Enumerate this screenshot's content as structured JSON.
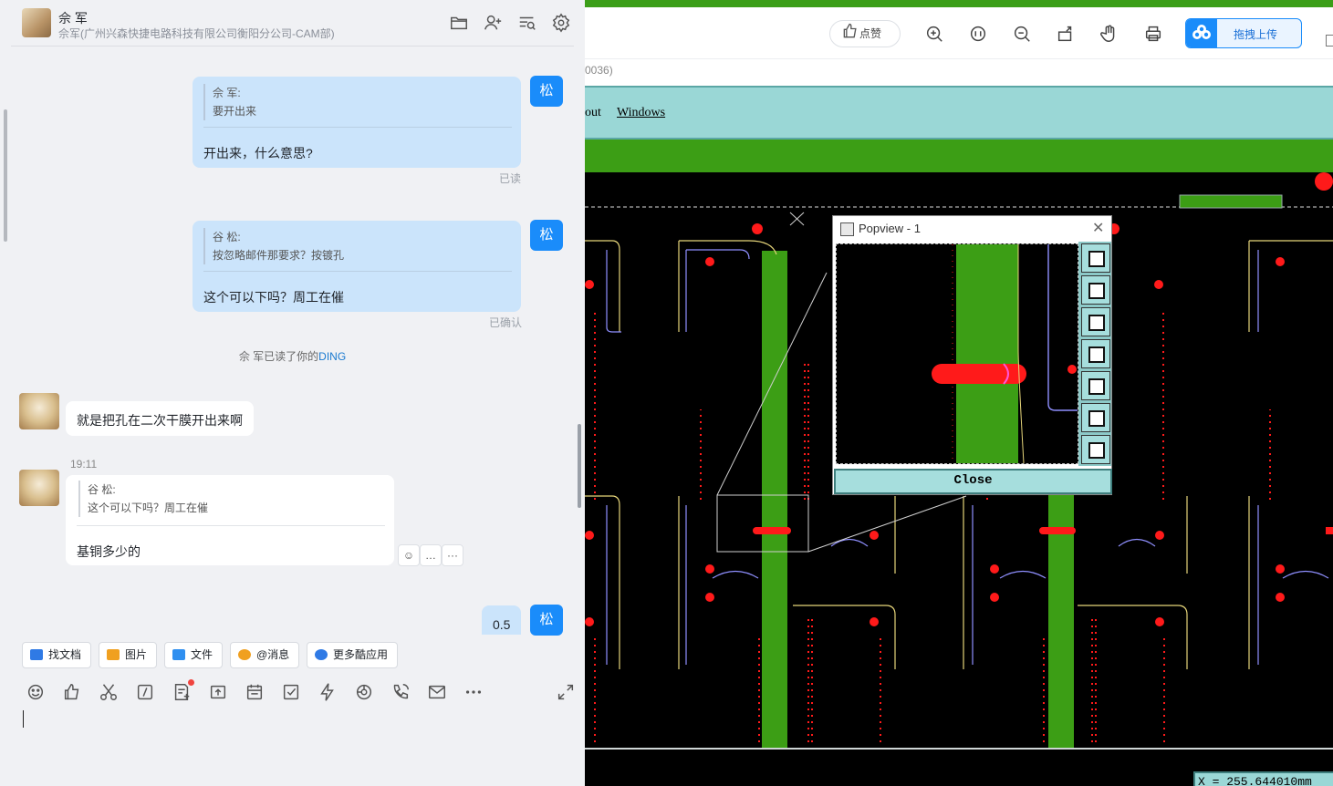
{
  "chat": {
    "contact_name": "佘 军",
    "contact_org": "佘军(广州兴森快捷电路科技有限公司衡阳分公司-CAM部)",
    "header_icons": [
      "folder-icon",
      "add-member-icon",
      "search-messages-icon",
      "gear-icon"
    ],
    "messages": {
      "m1": {
        "quote_author": "佘 军:",
        "quote_text": "要开出来",
        "text": "开出来，什么意思?",
        "status": "已读",
        "avatar_label": "松"
      },
      "m2": {
        "quote_author": "谷 松:",
        "quote_text": "按忽略邮件那要求？按镀孔",
        "text": "这个可以下吗？周工在催",
        "status": "已确认",
        "avatar_label": "松"
      },
      "system_note": {
        "prefix": "佘 军已读了你的",
        "highlight": "DING"
      },
      "m3": {
        "text": "就是把孔在二次干膜开出来啊"
      },
      "m4": {
        "time": "19:11",
        "quote_author": "谷 松:",
        "quote_text": "这个可以下吗？周工在催",
        "text": "基铜多少的"
      },
      "m5": {
        "text": "0.5",
        "avatar_label": "松"
      }
    },
    "quick_actions": [
      {
        "label": "找文档",
        "color": "#2f7ae5"
      },
      {
        "label": "图片",
        "color": "#f0a020"
      },
      {
        "label": "文件",
        "color": "#2f8ff0"
      },
      {
        "label": "@消息",
        "color": "#f0a020"
      },
      {
        "label": "更多酷应用",
        "color": "#2f7ae5"
      }
    ],
    "composer_tools": [
      "emoji-icon",
      "thumbs-up-icon",
      "scissors-icon",
      "slash-command-icon",
      "notes-icon",
      "upload-icon",
      "calendar-icon",
      "task-check-icon",
      "lightning-icon",
      "sticker-icon",
      "voice-call-icon",
      "mail-icon",
      "more-icon",
      "expand-icon"
    ]
  },
  "viewer": {
    "like_label": "点赞",
    "toolbar_icons": [
      "zoom-in-icon",
      "fit-icon",
      "zoom-out-icon",
      "rotate-icon",
      "hand-icon",
      "print-icon"
    ],
    "upload_label": "拖拽上传",
    "sub_line": "0036)",
    "cam_menu": [
      "out",
      "Windows"
    ],
    "coord_readout": "X = 255.644010mm",
    "popview": {
      "title": "Popview - 1",
      "close_label": "Close"
    }
  }
}
